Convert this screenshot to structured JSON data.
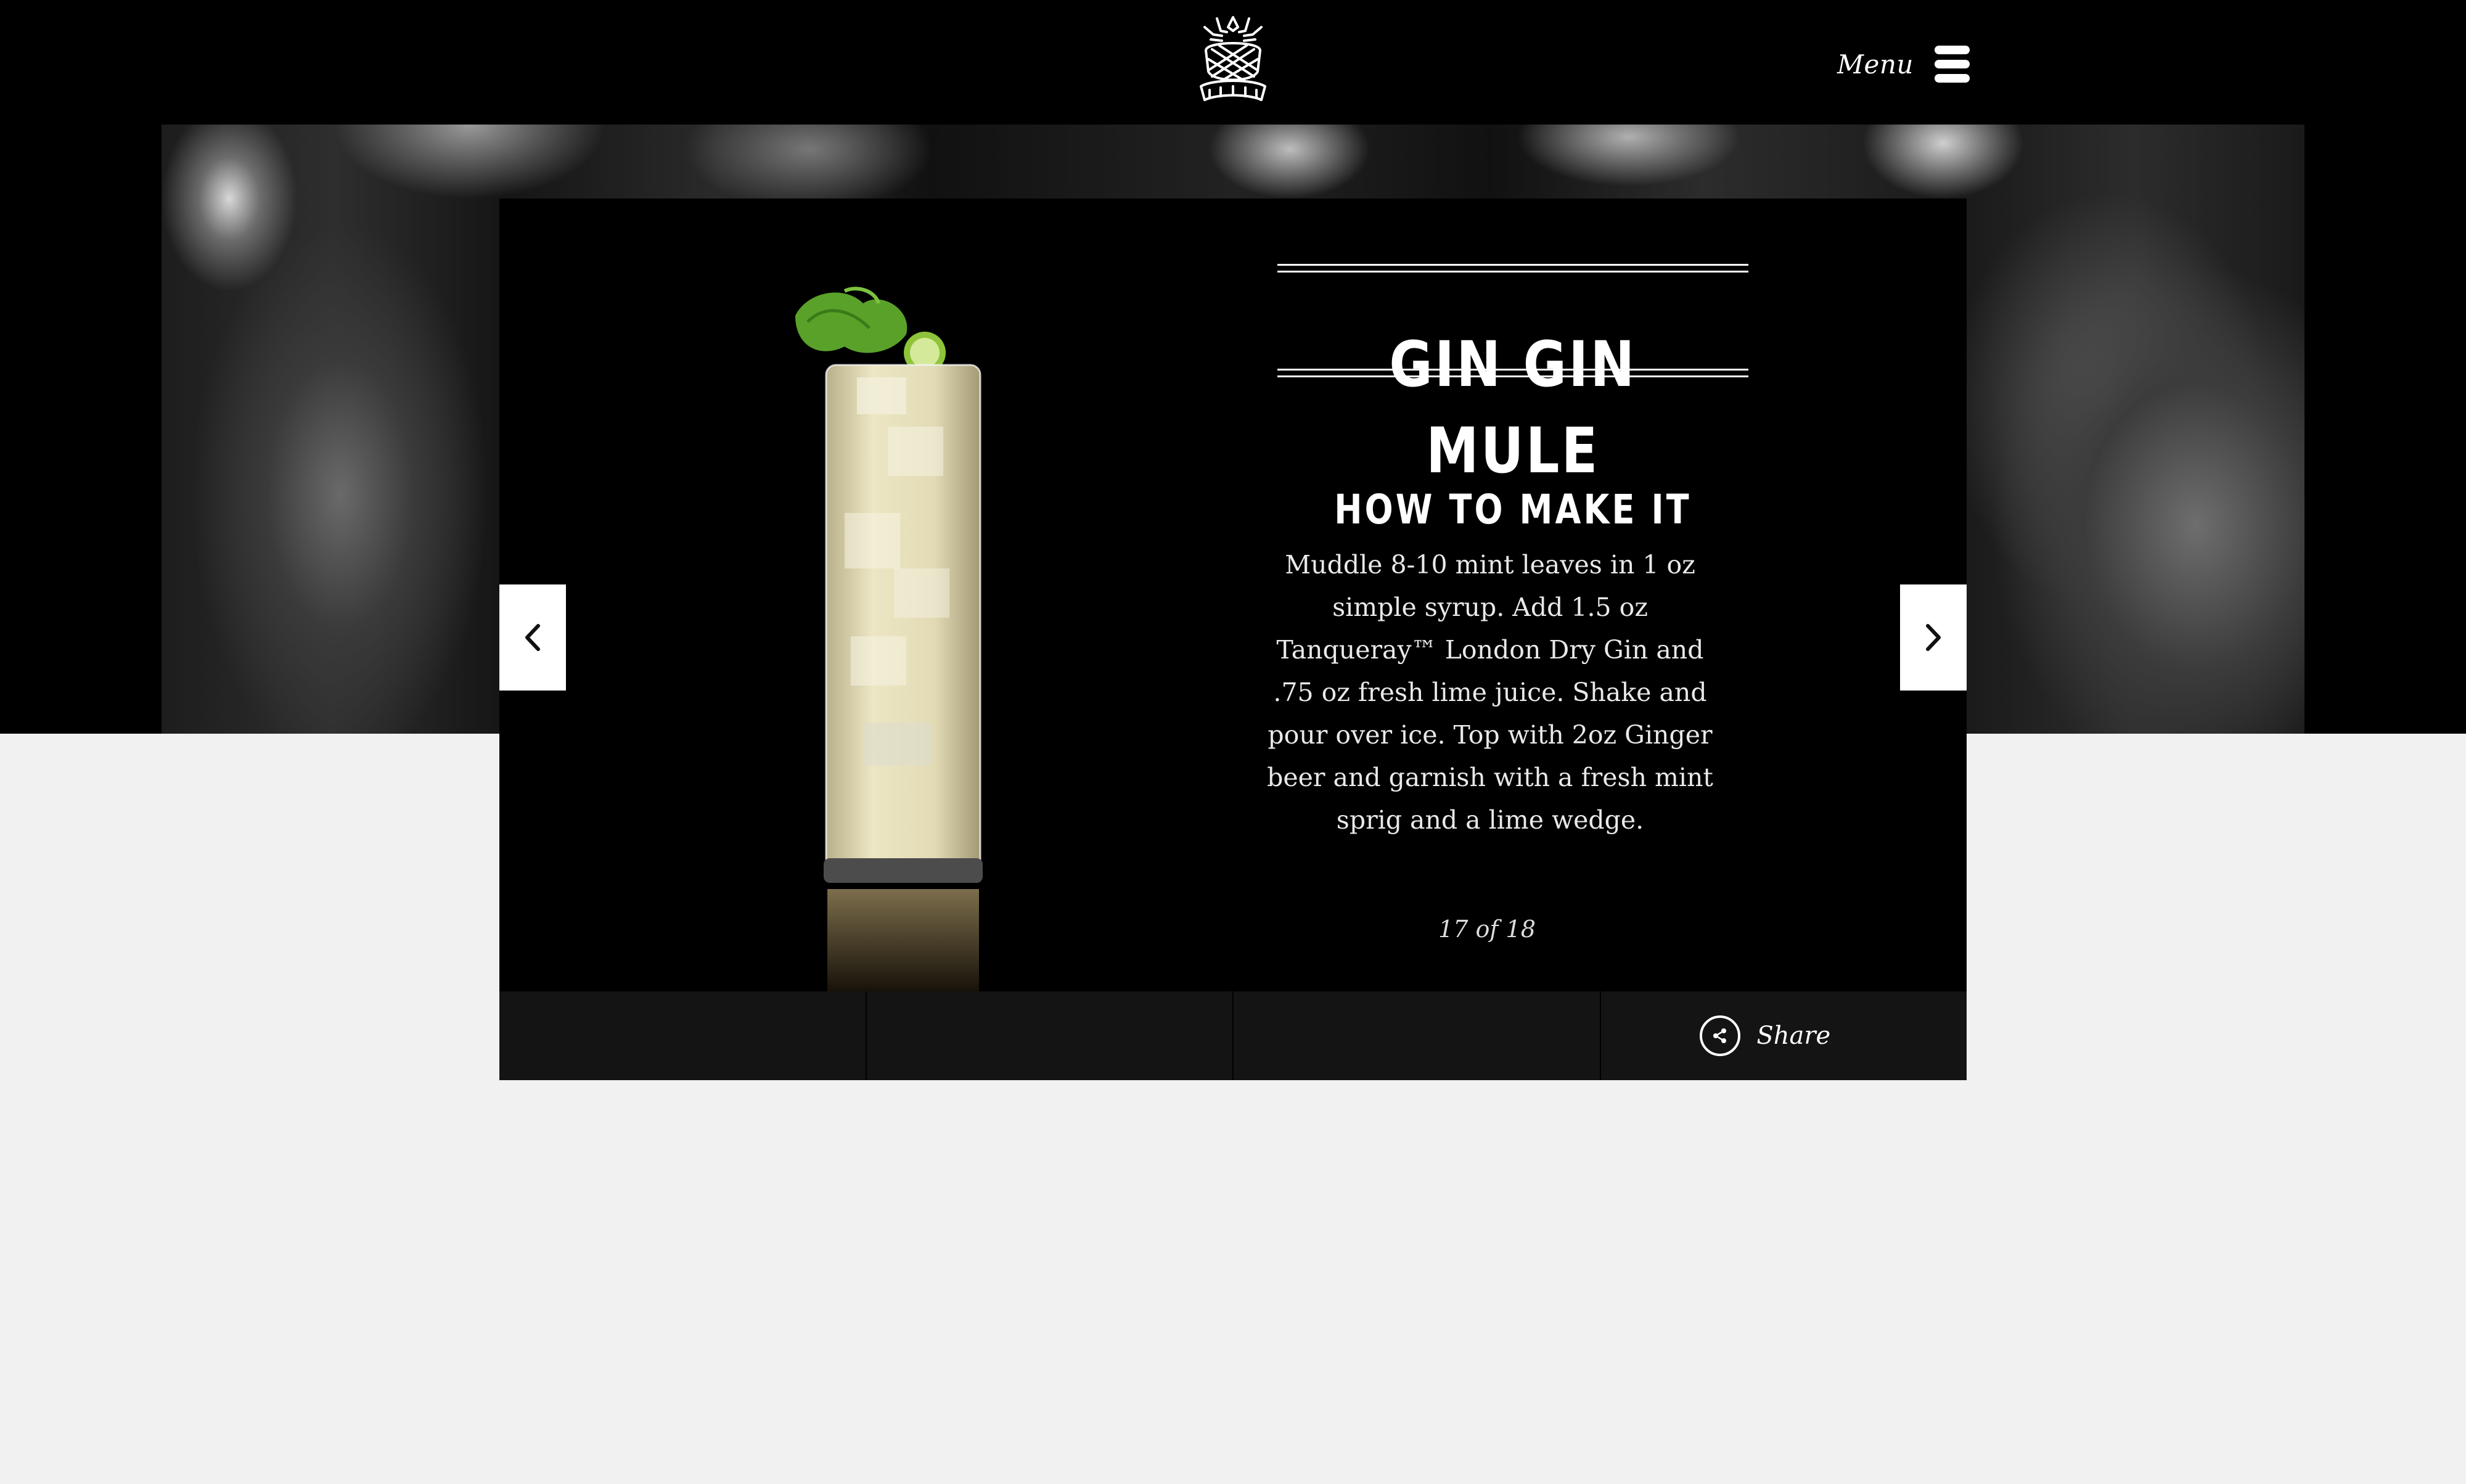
{
  "header": {
    "menu_label": "Menu"
  },
  "cocktail": {
    "name": "GIN GIN MULE",
    "section_heading": "HOW TO MAKE IT",
    "recipe": "Muddle 8-10 mint leaves in 1 oz simple syrup. Add 1.5 oz Tanqueray™ London Dry Gin and .75 oz fresh lime juice. Shake and pour over ice. Top with 2oz Ginger beer and garnish with a fresh mint sprig and a lime wedge.",
    "counter": "17 of 18"
  },
  "actions": {
    "share_label": "Share"
  },
  "icons": {
    "logo": "pineapple-crest-logo",
    "menu": "hamburger-icon",
    "prev": "chevron-left-icon",
    "next": "chevron-right-icon",
    "share": "share-icon"
  },
  "colors": {
    "background": "#f1f1f1",
    "band": "#000000",
    "card": "#000000",
    "action_bar": "#141414",
    "text": "#ffffff"
  }
}
